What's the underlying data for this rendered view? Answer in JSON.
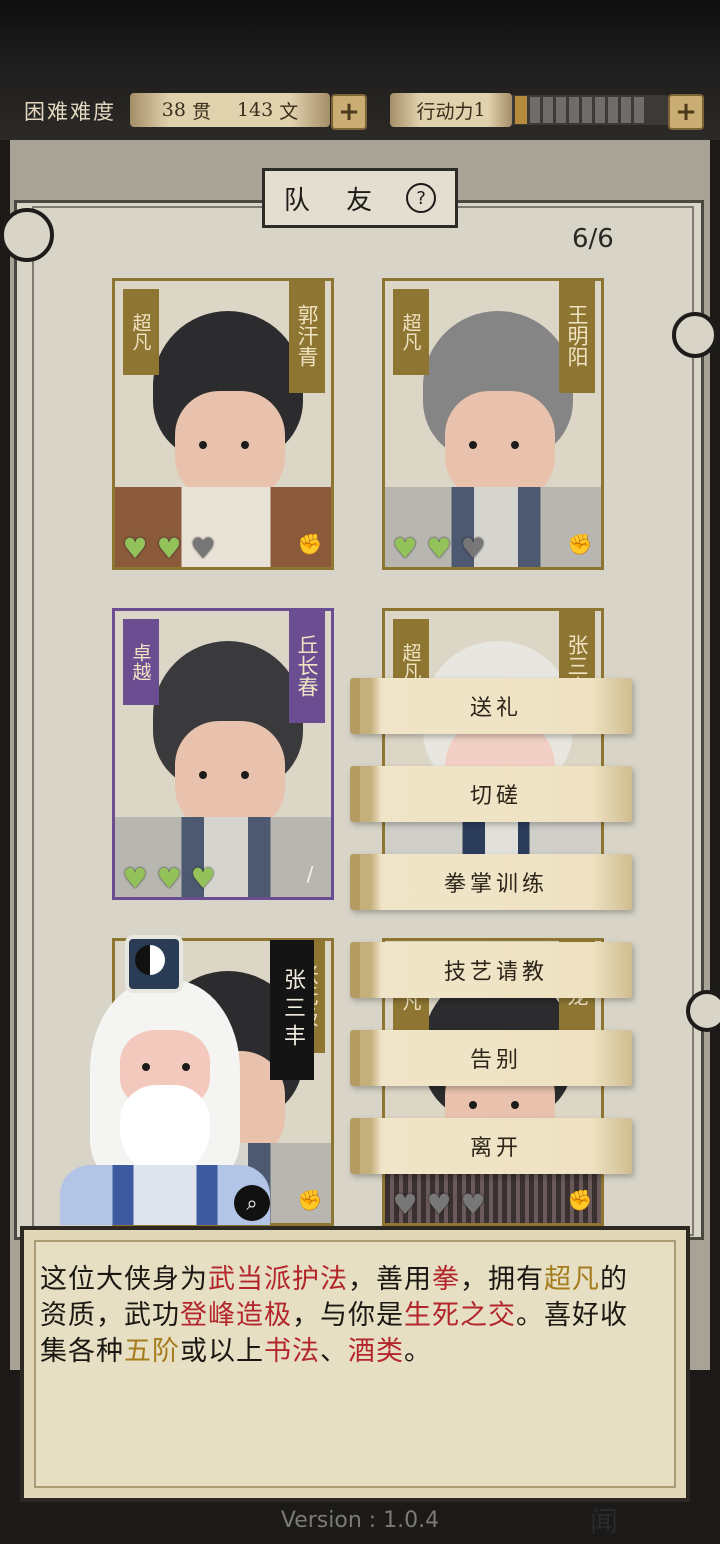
{
  "header": {
    "difficulty": "困难难度",
    "money_guan_value": "38",
    "money_guan_unit": "贯",
    "money_wen_value": "143",
    "money_wen_unit": "文",
    "action_label": "行动力",
    "action_value": "1",
    "action_max_segments": 10,
    "plus": "+"
  },
  "panel": {
    "title": "队 友",
    "help": "?",
    "count": "6/6"
  },
  "cards": [
    {
      "quality": "超凡",
      "name": "郭汗青",
      "hearts": [
        true,
        true,
        false
      ]
    },
    {
      "quality": "超凡",
      "name": "王明阳",
      "hearts": [
        true,
        true,
        false
      ]
    },
    {
      "quality": "卓越",
      "name": "丘长春",
      "hearts": [
        true,
        true,
        true
      ]
    },
    {
      "quality": "超凡",
      "name": "张三丰"
    },
    {
      "name": "张无极"
    },
    {
      "quality": "超凡",
      "name": "龙",
      "hearts": [
        false,
        false,
        false
      ]
    }
  ],
  "menu": [
    "送礼",
    "切磋",
    "拳掌训练",
    "技艺请教",
    "告别",
    "离开"
  ],
  "selected_character": {
    "name": "张三丰"
  },
  "description": {
    "segments": [
      {
        "text": "这位大侠身为",
        "style": ""
      },
      {
        "text": "武当派护法",
        "style": "r"
      },
      {
        "text": "，善用",
        "style": ""
      },
      {
        "text": "拳",
        "style": "r"
      },
      {
        "text": "，拥有",
        "style": ""
      },
      {
        "text": "超凡",
        "style": "y"
      },
      {
        "text": "的资质，武功",
        "style": ""
      },
      {
        "text": "登峰造极",
        "style": "r"
      },
      {
        "text": "，与你是",
        "style": ""
      },
      {
        "text": "生死之交",
        "style": "r"
      },
      {
        "text": "。喜好收集各种",
        "style": ""
      },
      {
        "text": "五阶",
        "style": "y"
      },
      {
        "text": "或以上",
        "style": ""
      },
      {
        "text": "书法",
        "style": "r"
      },
      {
        "text": "、",
        "style": ""
      },
      {
        "text": "酒类",
        "style": "r"
      },
      {
        "text": "。",
        "style": ""
      }
    ]
  },
  "footer": {
    "version": "Version : 1.0.4",
    "corner_glyph": "闻"
  },
  "colors": {
    "gold_border": "#8e7632",
    "purple_border": "#6b4d92",
    "heart_on": "#93c25a",
    "heart_off": "#777777",
    "highlight_red": "#b3262c",
    "highlight_gold": "#a57c1e"
  }
}
